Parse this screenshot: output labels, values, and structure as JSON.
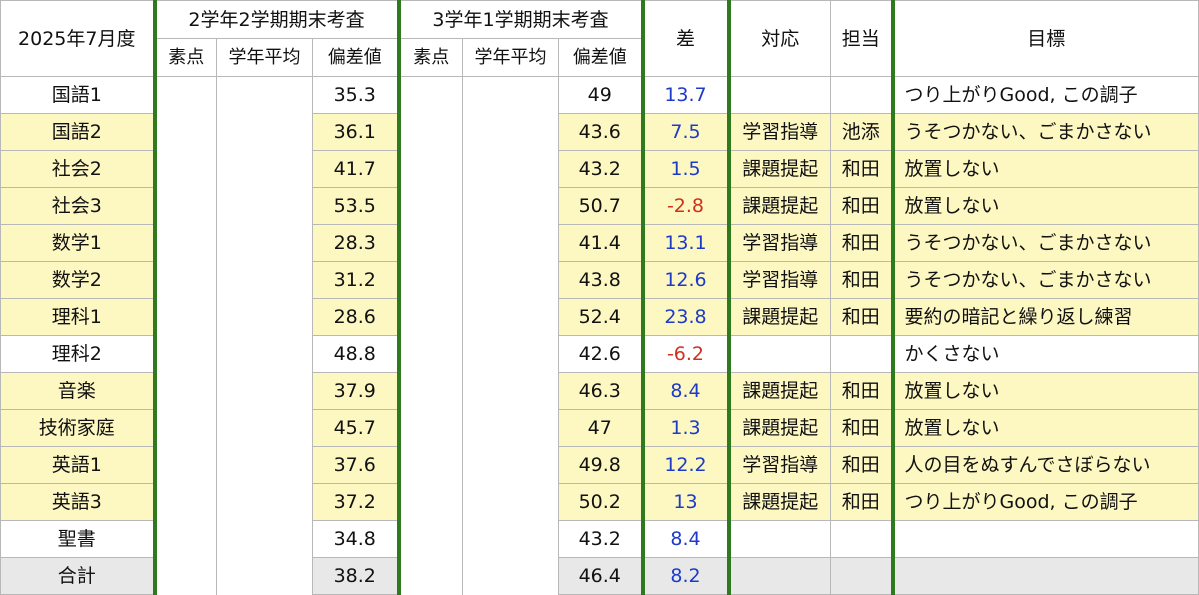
{
  "header": {
    "date_label": "2025年7月度",
    "term_a": "2学年2学期期末考査",
    "term_b": "3学年1学期期末考査",
    "sub_score": "素点",
    "sub_avg": "学年平均",
    "sub_dev": "偏差値",
    "diff": "差",
    "action": "対応",
    "owner": "担当",
    "goal": "目標"
  },
  "rows": [
    {
      "subject": "国語1",
      "a_dev": "35.3",
      "b_dev": "49",
      "diff": "13.7",
      "action": "",
      "owner": "",
      "goal": "つり上がりGood, この調子",
      "bg": "white",
      "diff_color": "blue"
    },
    {
      "subject": "国語2",
      "a_dev": "36.1",
      "b_dev": "43.6",
      "diff": "7.5",
      "action": "学習指導",
      "owner": "池添",
      "goal": "うそつかない、ごまかさない",
      "bg": "yellow",
      "diff_color": "blue"
    },
    {
      "subject": "社会2",
      "a_dev": "41.7",
      "b_dev": "43.2",
      "diff": "1.5",
      "action": "課題提起",
      "owner": "和田",
      "goal": "放置しない",
      "bg": "yellow",
      "diff_color": "blue"
    },
    {
      "subject": "社会3",
      "a_dev": "53.5",
      "b_dev": "50.7",
      "diff": "-2.8",
      "action": "課題提起",
      "owner": "和田",
      "goal": "放置しない",
      "bg": "yellow",
      "diff_color": "red"
    },
    {
      "subject": "数学1",
      "a_dev": "28.3",
      "b_dev": "41.4",
      "diff": "13.1",
      "action": "学習指導",
      "owner": "和田",
      "goal": "うそつかない、ごまかさない",
      "bg": "yellow",
      "diff_color": "blue"
    },
    {
      "subject": "数学2",
      "a_dev": "31.2",
      "b_dev": "43.8",
      "diff": "12.6",
      "action": "学習指導",
      "owner": "和田",
      "goal": "うそつかない、ごまかさない",
      "bg": "yellow",
      "diff_color": "blue"
    },
    {
      "subject": "理科1",
      "a_dev": "28.6",
      "b_dev": "52.4",
      "diff": "23.8",
      "action": "課題提起",
      "owner": "和田",
      "goal": "要約の暗記と繰り返し練習",
      "bg": "yellow",
      "diff_color": "blue"
    },
    {
      "subject": "理科2",
      "a_dev": "48.8",
      "b_dev": "42.6",
      "diff": "-6.2",
      "action": "",
      "owner": "",
      "goal": "かくさない",
      "bg": "white",
      "diff_color": "red"
    },
    {
      "subject": "音楽",
      "a_dev": "37.9",
      "b_dev": "46.3",
      "diff": "8.4",
      "action": "課題提起",
      "owner": "和田",
      "goal": "放置しない",
      "bg": "yellow",
      "diff_color": "blue"
    },
    {
      "subject": "技術家庭",
      "a_dev": "45.7",
      "b_dev": "47",
      "diff": "1.3",
      "action": "課題提起",
      "owner": "和田",
      "goal": "放置しない",
      "bg": "yellow",
      "diff_color": "blue"
    },
    {
      "subject": "英語1",
      "a_dev": "37.6",
      "b_dev": "49.8",
      "diff": "12.2",
      "action": "学習指導",
      "owner": "和田",
      "goal": "人の目をぬすんでさぼらない",
      "bg": "yellow",
      "diff_color": "blue"
    },
    {
      "subject": "英語3",
      "a_dev": "37.2",
      "b_dev": "50.2",
      "diff": "13",
      "action": "課題提起",
      "owner": "和田",
      "goal": "つり上がりGood, この調子",
      "bg": "yellow",
      "diff_color": "blue"
    },
    {
      "subject": "聖書",
      "a_dev": "34.8",
      "b_dev": "43.2",
      "diff": "8.4",
      "action": "",
      "owner": "",
      "goal": "",
      "bg": "white",
      "diff_color": "blue"
    },
    {
      "subject": "合計",
      "a_dev": "38.2",
      "b_dev": "46.4",
      "diff": "8.2",
      "action": "",
      "owner": "",
      "goal": "",
      "bg": "gray",
      "diff_color": "blue"
    }
  ]
}
